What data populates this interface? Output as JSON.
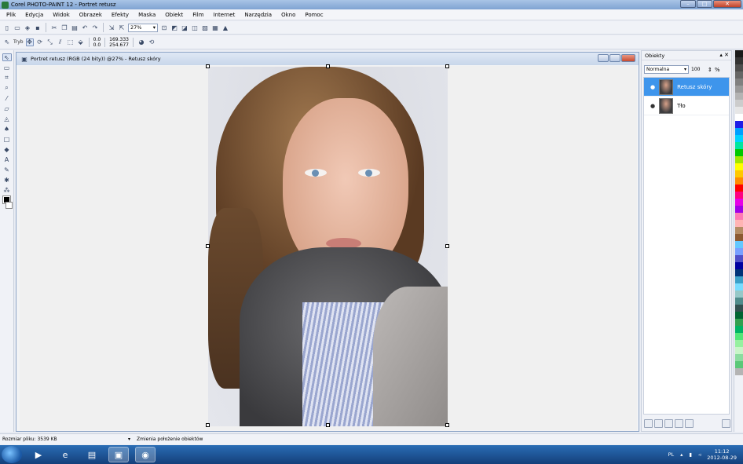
{
  "app": {
    "title": "Corel PHOTO-PAINT 12 - Portret retusz"
  },
  "menu": [
    "Plik",
    "Edycja",
    "Widok",
    "Obrazek",
    "Efekty",
    "Maska",
    "Obiekt",
    "Film",
    "Internet",
    "Narzędzia",
    "Okno",
    "Pomoc"
  ],
  "toolbar1": {
    "zoom": "27%"
  },
  "toolbar2": {
    "tryb_label": "Tryb",
    "x_offset": "0.0",
    "y_offset": "0.0",
    "x_pos": "169.333",
    "y_pos": "254.677"
  },
  "document": {
    "title": "Portret retusz (RGB (24 bity)) @27% - Retusz skóry"
  },
  "objects_panel": {
    "title": "Obiekty",
    "blend_mode": "Normalna",
    "opacity": "100",
    "opacity_unit": "%",
    "layers": [
      {
        "name": "Retusz skóry",
        "selected": true
      },
      {
        "name": "Tło",
        "selected": false
      }
    ]
  },
  "palette": [
    "#1a1a1a",
    "#333333",
    "#4d4d4d",
    "#666666",
    "#808080",
    "#999999",
    "#b3b3b3",
    "#cccccc",
    "#e6e6e6",
    "#ffffff",
    "#1e1ee6",
    "#00a0ff",
    "#00d2ff",
    "#00e6a0",
    "#00c800",
    "#a0e600",
    "#ffff00",
    "#ffc800",
    "#ff8c00",
    "#ff0000",
    "#ff0080",
    "#e600e6",
    "#a000e6",
    "#ff78b4",
    "#ffb4b4",
    "#b48c64",
    "#8c5a32",
    "#64c8ff",
    "#78a0ff",
    "#5050c8",
    "#0000a0",
    "#003278",
    "#3ca0c8",
    "#78dcff",
    "#96c8c8",
    "#508c8c",
    "#325050",
    "#006432",
    "#32a050",
    "#00b464",
    "#50e678",
    "#96f0a0",
    "#c8f5c8",
    "#8cdca0",
    "#5ac878",
    "#b4b4b4"
  ],
  "status": {
    "file_size": "Rozmiar pliku: 3539 KB",
    "message": "Zmienia położenie obiektów"
  },
  "taskbar": {
    "lang": "PL",
    "time": "11:12",
    "date": "2012-08-29"
  }
}
